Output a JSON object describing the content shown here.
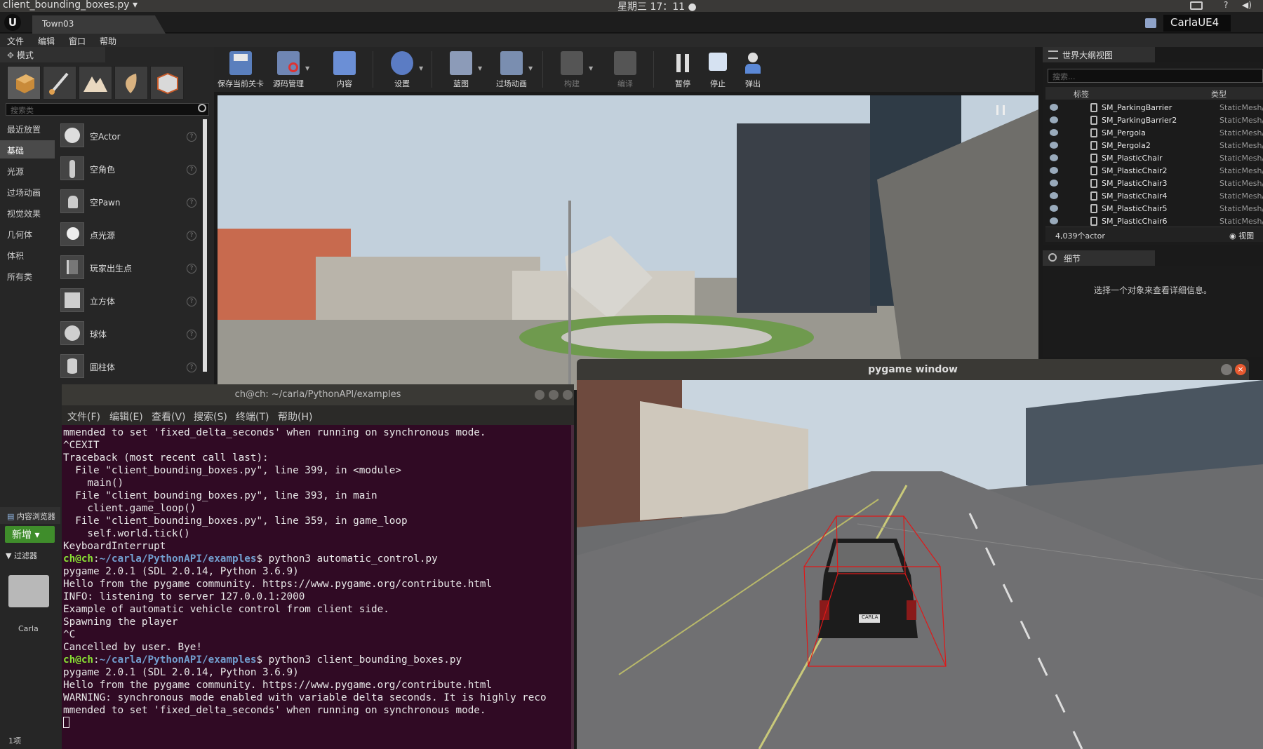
{
  "system": {
    "app_title": "client_bounding_boxes.py ▾",
    "clock": "星期三 17：11 ●"
  },
  "editor": {
    "level_tab": "Town03",
    "project_name": "CarlaUE4",
    "menu": [
      "文件",
      "编辑",
      "窗口",
      "帮助"
    ]
  },
  "modes": {
    "title": "模式",
    "search_placeholder": "搜索类",
    "categories": [
      "最近放置",
      "基础",
      "光源",
      "过场动画",
      "视觉效果",
      "几何体",
      "体积",
      "所有类"
    ],
    "active_category": "基础",
    "items": [
      "空Actor",
      "空角色",
      "空Pawn",
      "点光源",
      "玩家出生点",
      "立方体",
      "球体",
      "圆柱体"
    ],
    "help_glyph": "?"
  },
  "content_browser": {
    "tab": "内容浏览器",
    "new_button": "新增 ▾",
    "filter": "过滤器",
    "folder": "Carla",
    "count": "1项"
  },
  "toolbar": {
    "buttons": [
      "保存当前关卡",
      "源码管理",
      "内容",
      "设置",
      "蓝图",
      "过场动画",
      "构建",
      "编译",
      "暂停",
      "停止",
      "弹出"
    ]
  },
  "outliner": {
    "title": "世界大纲视图",
    "search_placeholder": "搜索...",
    "col_label": "标签",
    "col_type": "类型",
    "rows": [
      {
        "name": "SM_ParkingBarrier",
        "type": "StaticMesh/"
      },
      {
        "name": "SM_ParkingBarrier2",
        "type": "StaticMesh/"
      },
      {
        "name": "SM_Pergola",
        "type": "StaticMesh/"
      },
      {
        "name": "SM_Pergola2",
        "type": "StaticMesh/"
      },
      {
        "name": "SM_PlasticChair",
        "type": "StaticMesh/"
      },
      {
        "name": "SM_PlasticChair2",
        "type": "StaticMesh/"
      },
      {
        "name": "SM_PlasticChair3",
        "type": "StaticMesh/"
      },
      {
        "name": "SM_PlasticChair4",
        "type": "StaticMesh/"
      },
      {
        "name": "SM_PlasticChair5",
        "type": "StaticMesh/"
      },
      {
        "name": "SM_PlasticChair6",
        "type": "StaticMesh/"
      }
    ],
    "status": "4,039个actor",
    "view_option": "视图"
  },
  "details": {
    "title": "细节",
    "empty_message": "选择一个对象来查看详细信息。"
  },
  "terminal": {
    "title": "ch@ch: ~/carla/PythonAPI/examples",
    "menu": [
      "文件(F)",
      "编辑(E)",
      "查看(V)",
      "搜索(S)",
      "终端(T)",
      "帮助(H)"
    ],
    "lines": [
      {
        "text": "mmended to set 'fixed_delta_seconds' when running on synchronous mode."
      },
      {
        "text": "^CEXIT"
      },
      {
        "text": "Traceback (most recent call last):"
      },
      {
        "text": "  File \"client_bounding_boxes.py\", line 399, in <module>"
      },
      {
        "text": "    main()"
      },
      {
        "text": "  File \"client_bounding_boxes.py\", line 393, in main"
      },
      {
        "text": "    client.game_loop()"
      },
      {
        "text": "  File \"client_bounding_boxes.py\", line 359, in game_loop"
      },
      {
        "text": "    self.world.tick()"
      },
      {
        "text": "KeyboardInterrupt"
      },
      {
        "prompt_user": "ch@ch",
        "prompt_sep": ":",
        "prompt_path": "~/carla/PythonAPI/examples",
        "prompt_end": "$",
        "text": " python3 automatic_control.py"
      },
      {
        "text": "pygame 2.0.1 (SDL 2.0.14, Python 3.6.9)"
      },
      {
        "text": "Hello from the pygame community. https://www.pygame.org/contribute.html"
      },
      {
        "text": "INFO: listening to server 127.0.0.1:2000"
      },
      {
        "text": "Example of automatic vehicle control from client side."
      },
      {
        "text": "Spawning the player"
      },
      {
        "text": "^C"
      },
      {
        "text": "Cancelled by user. Bye!"
      },
      {
        "prompt_user": "ch@ch",
        "prompt_sep": ":",
        "prompt_path": "~/carla/PythonAPI/examples",
        "prompt_end": "$",
        "text": " python3 client_bounding_boxes.py"
      },
      {
        "text": "pygame 2.0.1 (SDL 2.0.14, Python 3.6.9)"
      },
      {
        "text": "Hello from the pygame community. https://www.pygame.org/contribute.html"
      },
      {
        "text": "WARNING: synchronous mode enabled with variable delta seconds. It is highly reco"
      },
      {
        "text": "mmended to set 'fixed_delta_seconds' when running on synchronous mode."
      }
    ]
  },
  "pygame": {
    "title": "pygame window",
    "close_glyph": "×",
    "plate": "CARLA"
  },
  "colors": {
    "terminal_bg": "#300a24",
    "prompt_user": "#8ae234",
    "prompt_path": "#729fcf",
    "bbox": "#e01818",
    "ue_new_button": "#3f8d2b"
  }
}
